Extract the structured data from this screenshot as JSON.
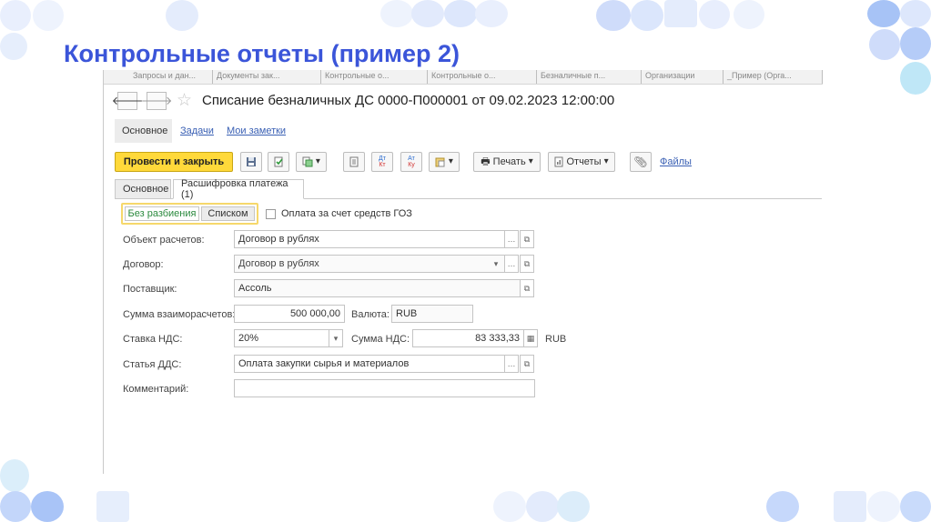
{
  "slide": {
    "title": "Контрольные отчеты (пример 2)",
    "accent": "#3b55d9"
  },
  "top_tabs": [
    "Запросы и дан...",
    "Документы зак...",
    "Контрольные о...",
    "Контрольные о...",
    "Безналичные п...",
    "Организации",
    "_Пример (Орга..."
  ],
  "document": {
    "title": "Списание безналичных ДС 0000-П000001 от 09.02.2023 12:00:00",
    "back_icon": "arrow-left-icon",
    "forward_icon": "arrow-right-icon",
    "star_icon": "star-icon"
  },
  "subnav": {
    "main": "Основное",
    "tasks": "Задачи",
    "notes": "Мои заметки"
  },
  "toolbar": {
    "post_close": "Провести и закрыть",
    "print": "Печать",
    "reports": "Отчеты",
    "files": "Файлы",
    "dt_kt_top": "Дт",
    "dt_kt_bottom": "Кт",
    "at_top": "Ат",
    "at_bottom": "Ку",
    "primary_color": "#ffd93a"
  },
  "form_tabs": {
    "main": "Основное",
    "payment_details": "Расшифровка платежа (1)"
  },
  "split": {
    "no_split": "Без разбиения",
    "list": "Списком",
    "goz_checkbox": "Оплата за счет средств ГОЗ",
    "goz_checked": false
  },
  "fields": {
    "settlement_object_label": "Объект расчетов:",
    "settlement_object_value": "Договор в рублях",
    "contract_label": "Договор:",
    "contract_value": "Договор в рублях",
    "supplier_label": "Поставщик:",
    "supplier_value": "Ассоль",
    "amount_label": "Сумма взаиморасчетов:",
    "amount_value": "500 000,00",
    "currency_label": "Валюта:",
    "currency_value": "RUB",
    "vat_rate_label": "Ставка НДС:",
    "vat_rate_value": "20%",
    "vat_amount_label": "Сумма НДС:",
    "vat_amount_value": "83 333,33",
    "vat_currency": "RUB",
    "cashflow_label": "Статья ДДС:",
    "cashflow_value": "Оплата закупки сырья и материалов",
    "comment_label": "Комментарий:",
    "comment_value": ""
  }
}
